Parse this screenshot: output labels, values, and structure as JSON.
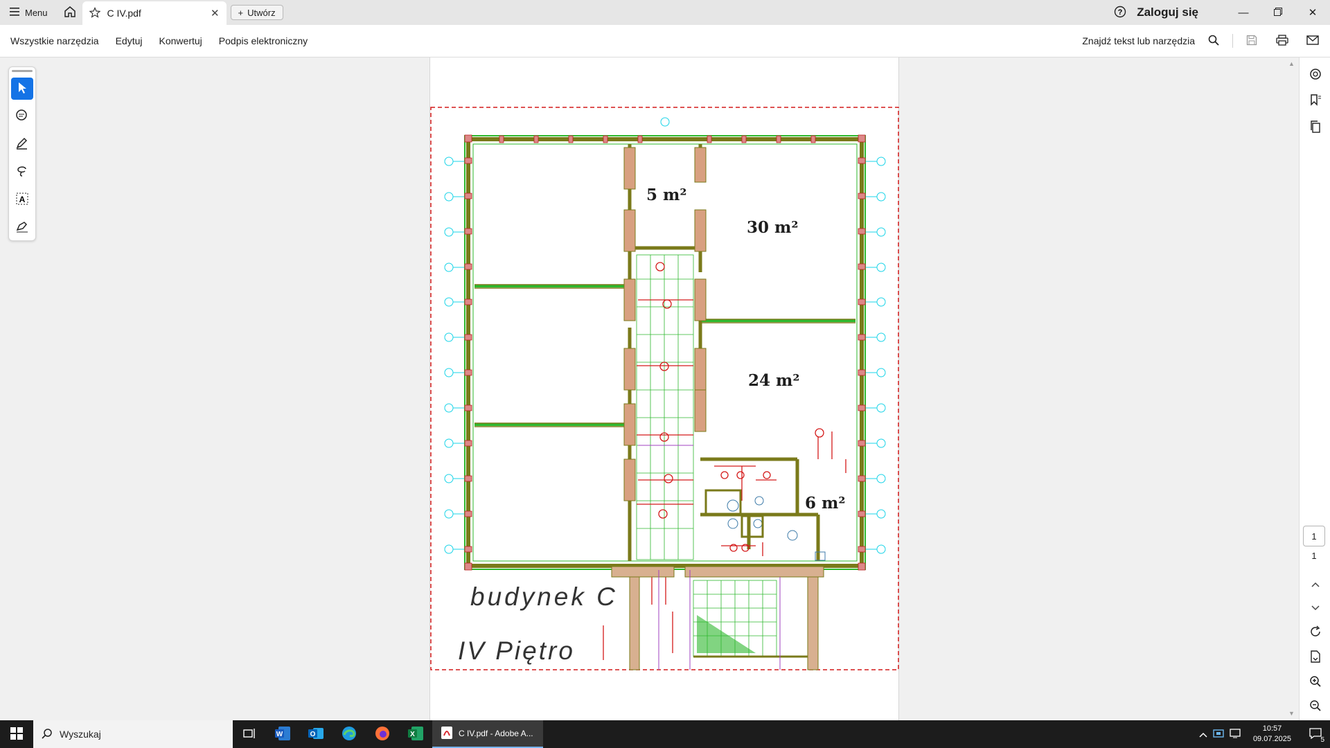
{
  "titlebar": {
    "menu_label": "Menu",
    "tab_title": "C IV.pdf",
    "new_label": "Utwórz",
    "login_label": "Zaloguj się"
  },
  "menubar": {
    "items": [
      "Wszystkie narzędzia",
      "Edytuj",
      "Konwertuj",
      "Podpis elektroniczny"
    ],
    "find_label": "Znajdź tekst lub narzędzia"
  },
  "document": {
    "room_labels": [
      "5 m²",
      "30 m²",
      "24 m²",
      "6 m²"
    ],
    "building_label": "budynek C",
    "floor_label": "IV Piętro"
  },
  "navigation": {
    "current_page": "1",
    "total_pages": "1"
  },
  "taskbar": {
    "search_placeholder": "Wyszukaj",
    "active_app_label": "C IV.pdf - Adobe A...",
    "time": "10:57",
    "date": "09.07.2025",
    "notification_count": "5"
  },
  "colors": {
    "accent": "#1473e6",
    "wall": "#7a7a1a",
    "grid_dim": "#19d4e8",
    "red_lines": "#d41a1a"
  }
}
